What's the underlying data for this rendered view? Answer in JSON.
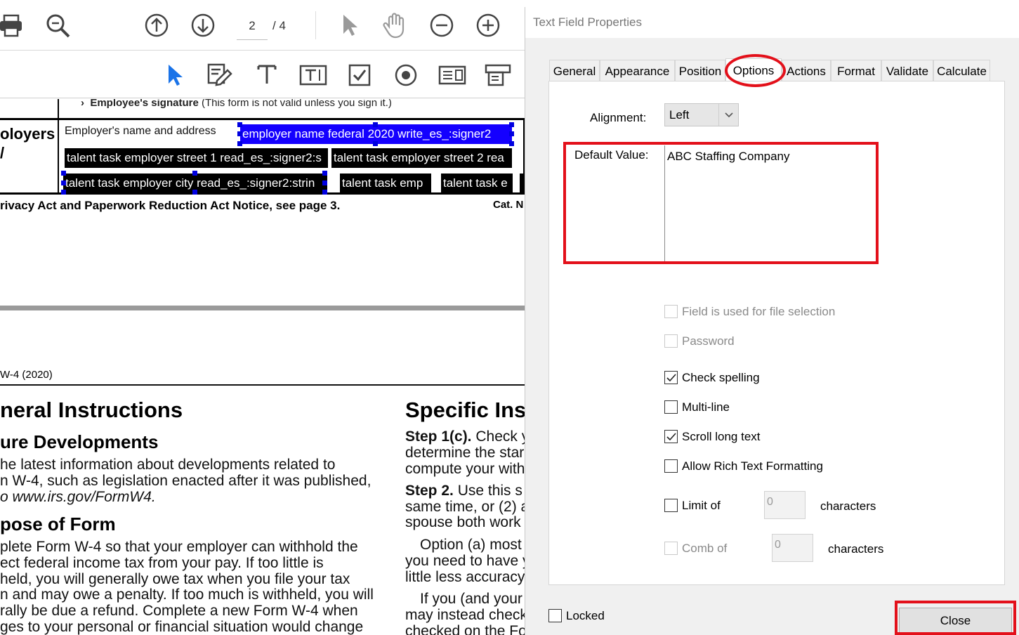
{
  "toolbar": {
    "page_current": "2",
    "page_total": "/ 4",
    "icons_row1": [
      "print-icon",
      "zoom-icon",
      "page-up-icon",
      "page-down-icon",
      "select-cursor-icon",
      "hand-icon",
      "zoom-out-icon",
      "zoom-in-icon"
    ],
    "icons_row2": [
      "select-object-icon",
      "edit-form-icon",
      "text-field-icon",
      "text-box-icon",
      "checkbox-tool-icon",
      "radio-tool-icon",
      "list-box-icon",
      "dropdown-tool-icon"
    ]
  },
  "document": {
    "signature_line": "Employee's signature",
    "signature_note": "(This form is not valid unless you sign it.)",
    "employers_fragment": "oloyers",
    "employer_label": "Employer's name and address",
    "fields": {
      "name": "employer name federal 2020 write_es_:signer2",
      "street1": "talent task employer street 1 read_es_:signer2:s",
      "street2": "talent task employer street 2 rea",
      "city": "talent task employer city read_es_:signer2:strin",
      "state": "talent task emp",
      "zip": "talent task e"
    },
    "privacy_notice": "rivacy Act and Paperwork Reduction Act Notice, see page 3.",
    "cat_fragment": "Cat. N",
    "form_id": "W-4 (2020)",
    "left_column": {
      "heading": "neral Instructions",
      "sub1": "ure Developments",
      "p1": [
        "he latest information about developments related to",
        "n W-4, such as legislation enacted after it was published,",
        "o www.irs.gov/FormW4."
      ],
      "sub2": "pose of Form",
      "p2": [
        "plete Form W-4 so that your employer can withhold the",
        "ect federal income tax from your pay. If too little is",
        "held, you will generally owe tax when you file your tax",
        "n and may owe a penalty. If too much is withheld, you will",
        "rally be due a refund. Complete a new Form W-4 when",
        "ges to your personal or financial situation would change"
      ]
    },
    "right_column": {
      "heading": "Specific Ins",
      "step1_bold": "Step 1(c).",
      "step1_lines": [
        " Check y",
        "determine the star",
        "compute your with"
      ],
      "step2_bold": "Step 2.",
      "step2_lines": [
        " Use this s",
        "same time, or (2) a",
        "spouse both work"
      ],
      "opt_lines": [
        "Option (a) most",
        "you need to have y",
        "little less accuracy"
      ],
      "if_lines": [
        "If you (and your s",
        "may instead check",
        "checked on the Fo"
      ]
    }
  },
  "dialog": {
    "title": "Text Field Properties",
    "tabs": [
      "General",
      "Appearance",
      "Position",
      "Options",
      "Actions",
      "Format",
      "Validate",
      "Calculate"
    ],
    "active_tab": "Options",
    "alignment_label": "Alignment:",
    "alignment_value": "Left",
    "default_value_label": "Default Value:",
    "default_value": "ABC Staffing Company",
    "options": {
      "file_selection": "Field is used for file selection",
      "password": "Password",
      "check_spelling": "Check spelling",
      "multi_line": "Multi-line",
      "scroll_long_text": "Scroll long text",
      "rich_text": "Allow Rich Text Formatting",
      "limit_of": "Limit of",
      "limit_value": "0",
      "limit_unit": "characters",
      "comb_of": "Comb of",
      "comb_value": "0",
      "comb_unit": "characters"
    },
    "checked": {
      "check_spelling": true,
      "scroll_long_text": true,
      "multi_line": false,
      "rich_text": false,
      "limit_of": false,
      "locked": false
    },
    "locked_label": "Locked",
    "close_label": "Close",
    "highlight_color": "#e3101a"
  }
}
